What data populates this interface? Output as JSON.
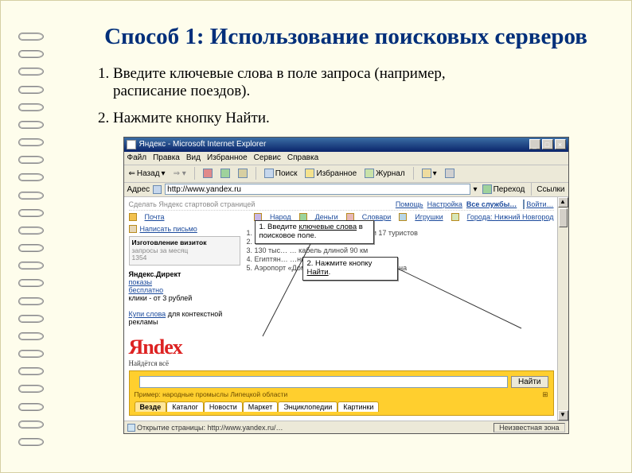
{
  "heading": "Способ 1: Использование поисковых серверов",
  "steps": [
    "Введите ключевые слова в поле запроса (например, расписание поездов).",
    "Нажмите кнопку Найти."
  ],
  "browser": {
    "title": "Яндекс - Microsoft Internet Explorer",
    "window_buttons": {
      "min": "_",
      "max": "□",
      "close": "×"
    },
    "menu": [
      "Файл",
      "Правка",
      "Вид",
      "Избранное",
      "Сервис",
      "Справка"
    ],
    "nav": {
      "back": "Назад",
      "forward": " ",
      "stop": " ",
      "refresh": " ",
      "home": " ",
      "search": "Поиск",
      "favorites": "Избранное",
      "history": "Журнал",
      "mail": " ",
      "print": " "
    },
    "addr_label": "Адрес",
    "addr_value": "http://www.yandex.ru",
    "go": "Переход",
    "links_label": "Ссылки"
  },
  "yandex": {
    "topleft": "Сделать Яндекс стартовой страницей",
    "topright": [
      "Помощь",
      "Настройка",
      "Все службы…"
    ],
    "login": "Войти…",
    "row1": [
      {
        "i": "mail",
        "t": "Почта"
      },
      {
        "i": "people",
        "t": "Народ"
      },
      {
        "i": "money",
        "t": "Деньги"
      },
      {
        "i": "dict",
        "t": "Словари"
      },
      {
        "i": "toys",
        "t": "Игрушки"
      },
      {
        "i": "city",
        "t": "Города: Нижний Новгород"
      }
    ],
    "row2_left": {
      "i": "write",
      "t": "Написать письмо"
    },
    "callout1": {
      "pre": "1. Введите ",
      "u": "ключевые слова",
      "post": " в поисковое поле."
    },
    "callout2": {
      "pre": "2. Нажмите кнопку ",
      "u": "Найти",
      "post": "."
    },
    "direct_title": "Яндекс.Директ",
    "direct_lines": [
      "показы",
      "бесплатно",
      "клики - от 3 рублей"
    ],
    "ad_title": "Изготовление визиток",
    "ad_sub1": "запросы за месяц",
    "ad_sub2": "1354",
    "ad_link": "Купи слова",
    "ad_tail": " для контекстной рекламы",
    "news": [
      "1.  Взрыв в отеле в Турции: пострадали 17 туристов",
      "2.  D Doro…",
      "3.  130 тыс…                                     … кабель длиной 90 км",
      "4.  Египтян…                                   …ниться террористам",
      "5.  Аэропорт «Домодедово» закрыт из-за тумана"
    ],
    "logo_main": "Яndex",
    "logo_sub": "Найдётся всё",
    "search_button": "Найти",
    "hint": "Пример: народные промыслы Липецкой области",
    "tabs": [
      "Везде",
      "Каталог",
      "Новости",
      "Маркет",
      "Энциклопедии",
      "Картинки"
    ]
  },
  "statusbar": {
    "left_icon": "globe",
    "left": "Открытие страницы: http://www.yandex.ru/…",
    "zone": "Неизвестная зона"
  }
}
